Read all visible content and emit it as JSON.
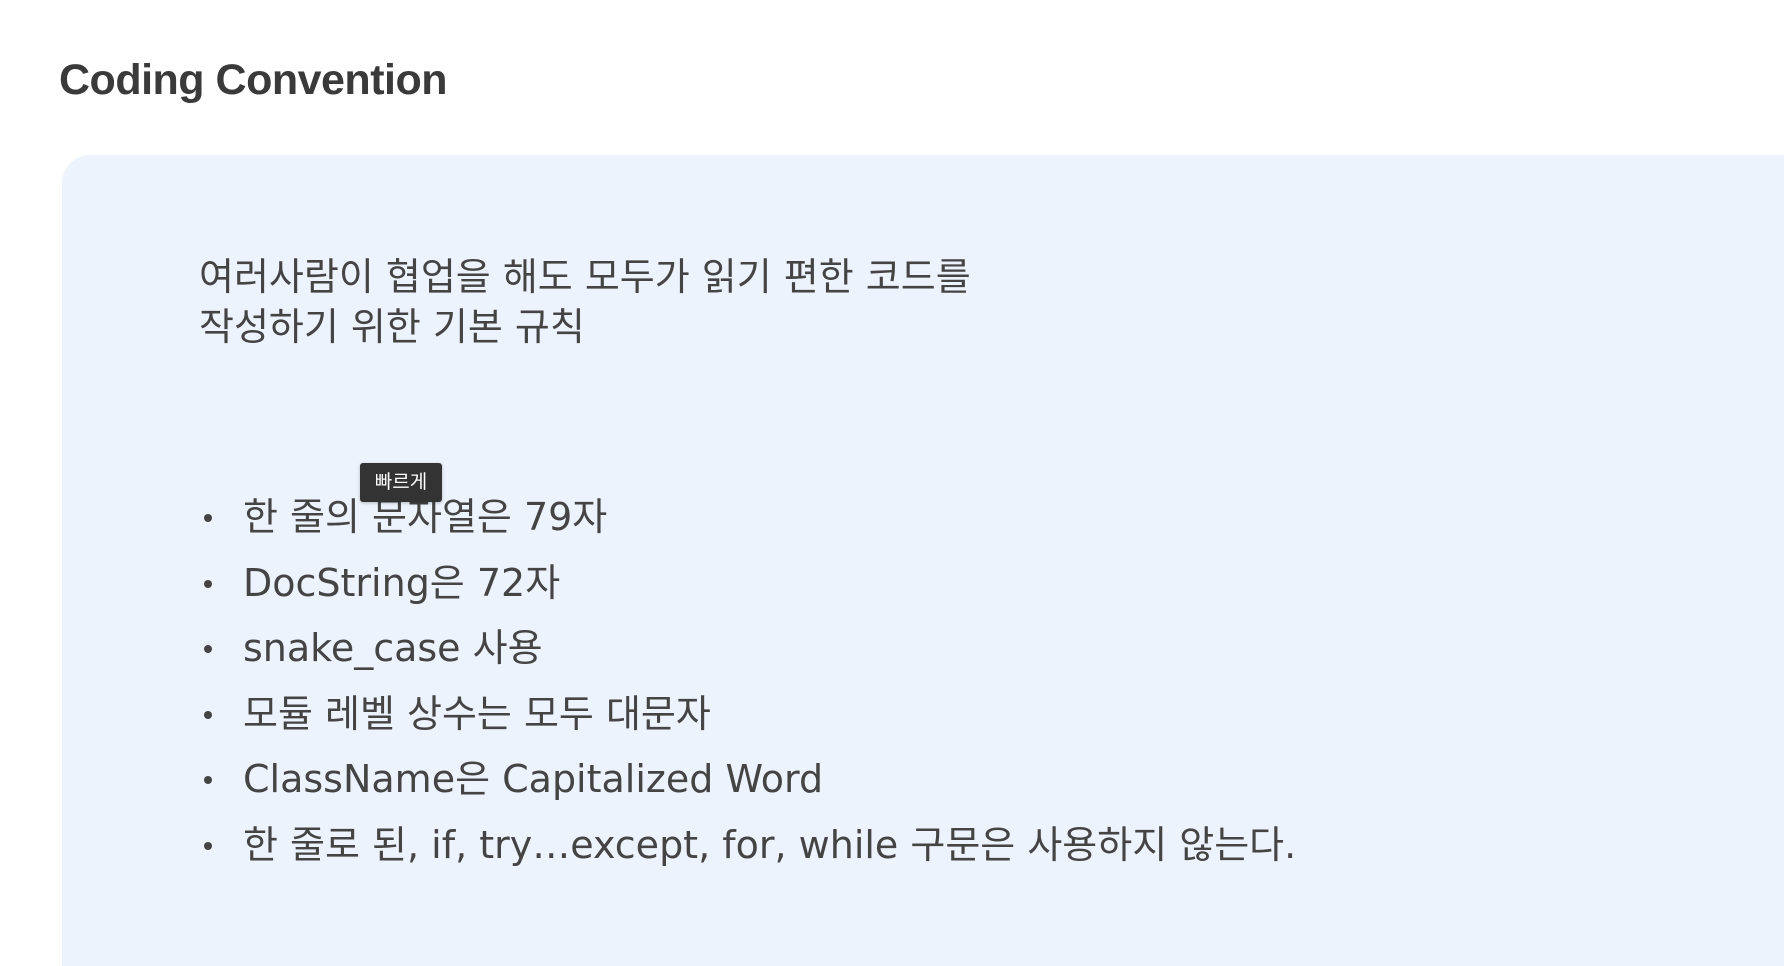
{
  "page": {
    "title": "Coding Convention"
  },
  "callout": {
    "description_lines": [
      "여러사람이 협업을 해도 모두가 읽기 편한 코드를",
      "작성하기 위한 기본 규칙"
    ],
    "rules": [
      "한 줄의 문자열은 79자",
      "DocString은 72자",
      "snake_case 사용",
      "모듈 레벨 상수는 모두 대문자",
      "ClassName은 Capitalized Word",
      "한 줄로 된, if, try…except, for, while 구문은 사용하지 않는다."
    ]
  },
  "tooltip": {
    "text": "빠르게"
  },
  "colors": {
    "callout_background": "#edf3fd",
    "text": "#444444",
    "tooltip_background": "#333333"
  }
}
